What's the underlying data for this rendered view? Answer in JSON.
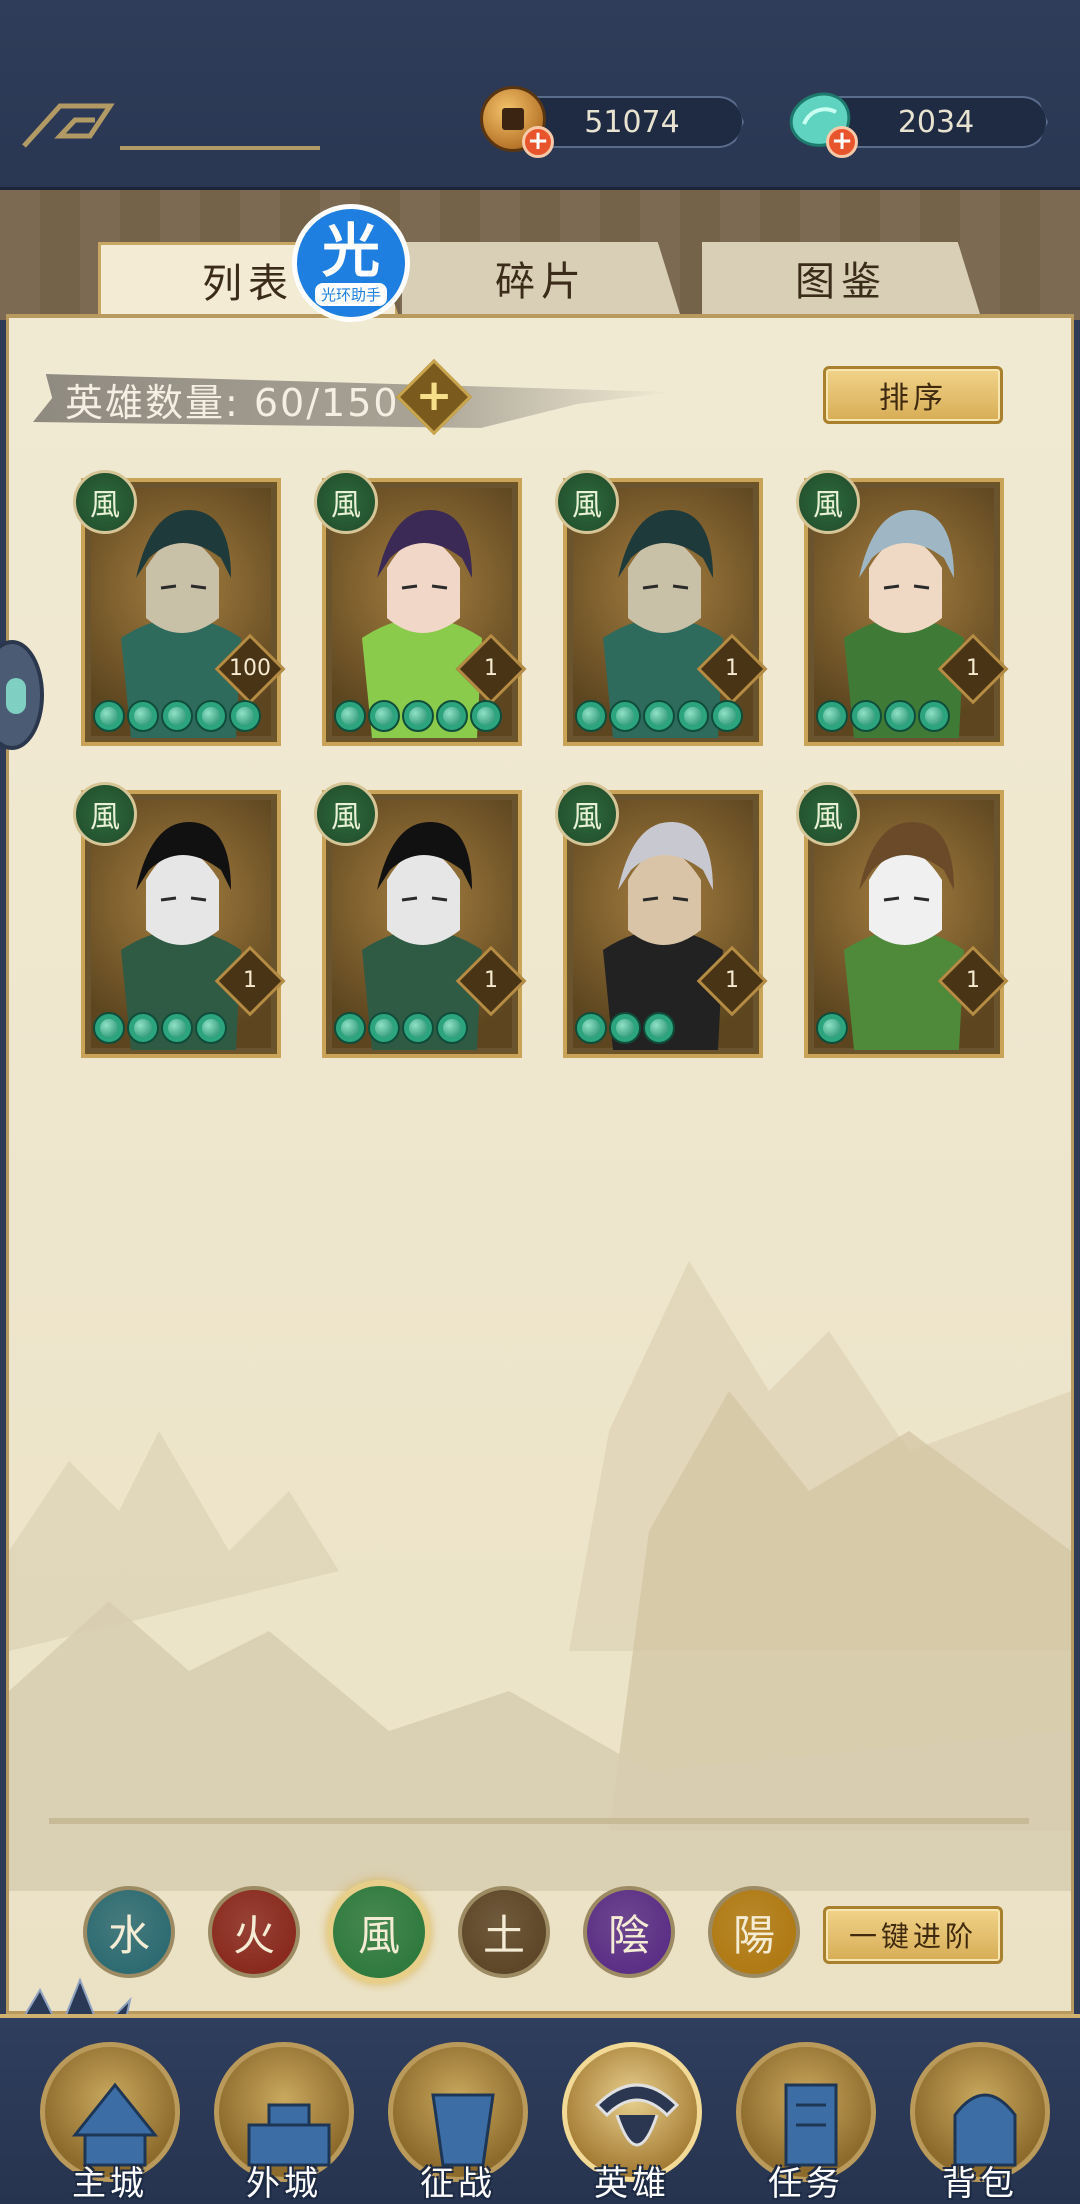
{
  "currency": {
    "copper": "51074",
    "jade": "2034"
  },
  "tabs": [
    "列表",
    "碎片",
    "图鉴"
  ],
  "halo_badge": {
    "glyph": "光",
    "caption": "光环助手"
  },
  "hero_count": {
    "label": "英雄数量: 60/150",
    "plus": "+"
  },
  "sort_button": "排序",
  "heroes": [
    {
      "element": "風",
      "level": "100",
      "stars": 5
    },
    {
      "element": "風",
      "level": "1",
      "stars": 5
    },
    {
      "element": "風",
      "level": "1",
      "stars": 5
    },
    {
      "element": "風",
      "level": "1",
      "stars": 4
    },
    {
      "element": "風",
      "level": "1",
      "stars": 4
    },
    {
      "element": "風",
      "level": "1",
      "stars": 4
    },
    {
      "element": "風",
      "level": "1",
      "stars": 3
    },
    {
      "element": "風",
      "level": "1",
      "stars": 1
    }
  ],
  "element_filters": [
    {
      "glyph": "水",
      "color": "#2d6b72",
      "selected": false
    },
    {
      "glyph": "火",
      "color": "#8a2a1f",
      "selected": false
    },
    {
      "glyph": "風",
      "color": "#2f7a3e",
      "selected": true
    },
    {
      "glyph": "土",
      "color": "#5e4628",
      "selected": false
    },
    {
      "glyph": "陰",
      "color": "#5b2f86",
      "selected": false
    },
    {
      "glyph": "陽",
      "color": "#b07a14",
      "selected": false
    }
  ],
  "upgrade_all_button": "一键进阶",
  "nav": [
    "主城",
    "外城",
    "征战",
    "英雄",
    "任务",
    "背包"
  ],
  "icons": {
    "coin": "copper-coin-icon",
    "jade": "jade-icon",
    "plus": "plus-icon"
  }
}
